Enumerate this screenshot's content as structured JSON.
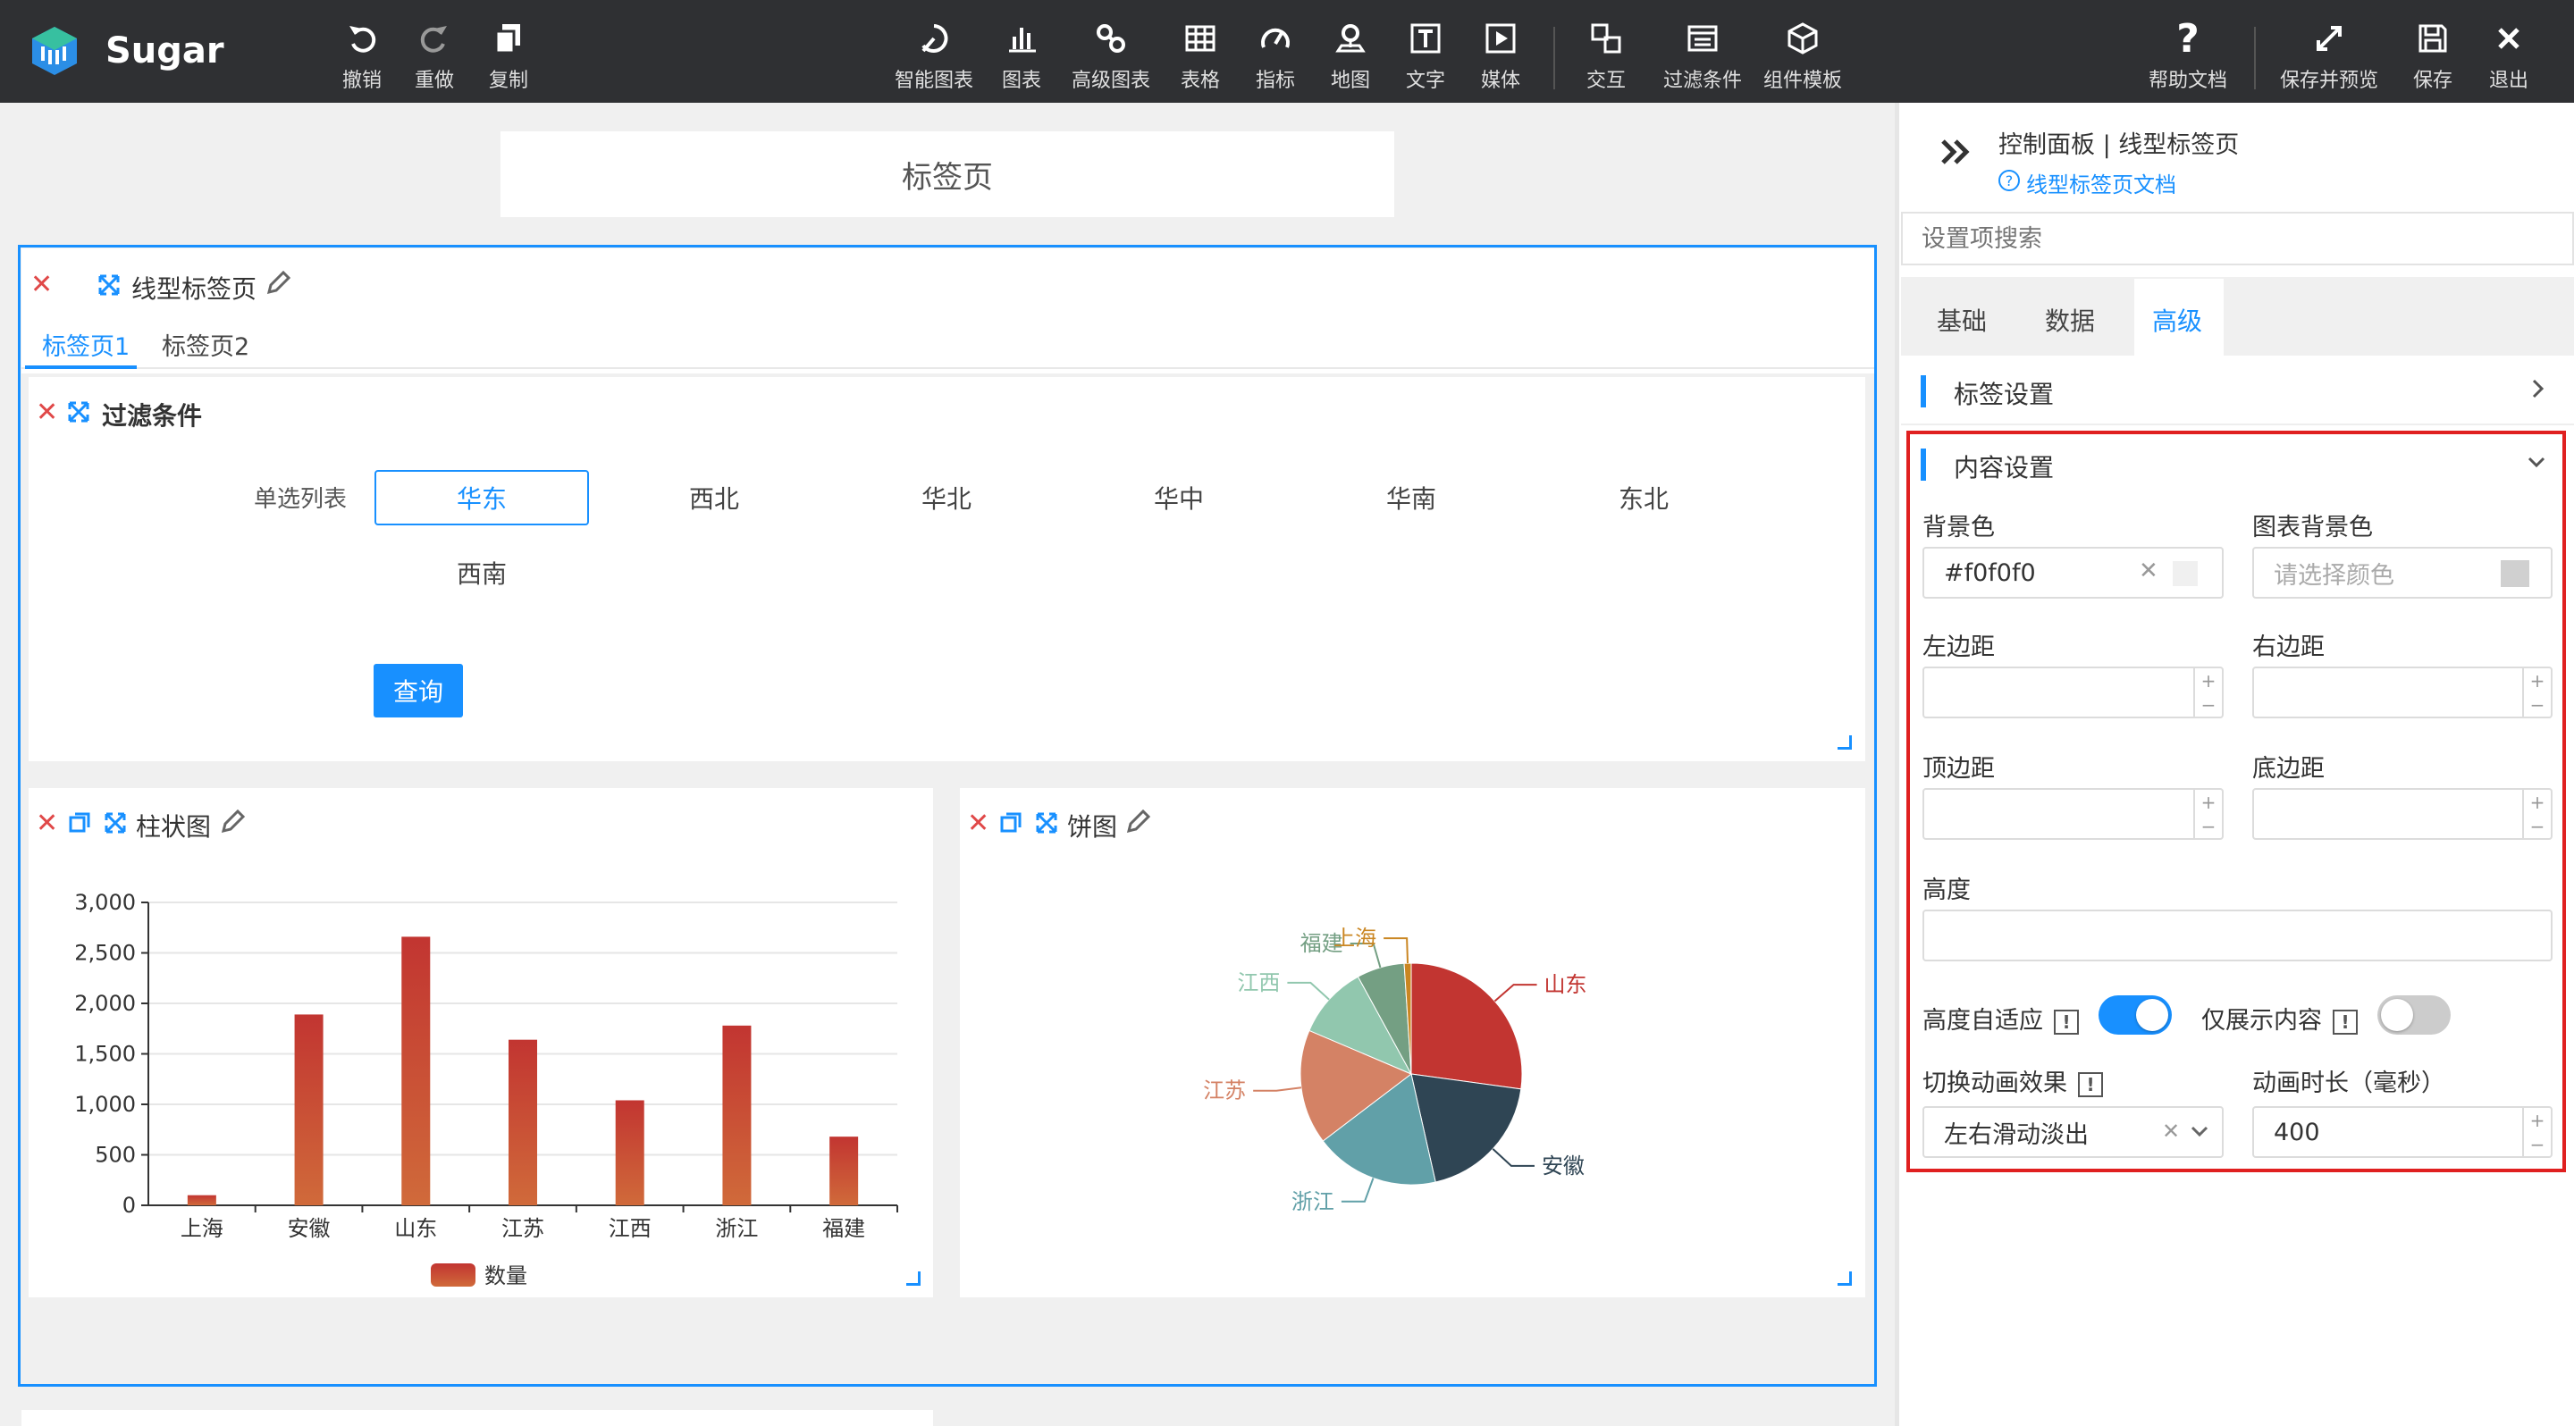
{
  "app": {
    "name": "Sugar"
  },
  "toolbar": {
    "undo": "撤销",
    "redo": "重做",
    "copy": "复制",
    "smart_chart": "智能图表",
    "chart": "图表",
    "adv_chart": "高级图表",
    "table": "表格",
    "metric": "指标",
    "map": "地图",
    "text": "文字",
    "media": "媒体",
    "interact": "交互",
    "filter": "过滤条件",
    "component_tpl": "组件模板",
    "help": "帮助文档",
    "save_preview": "保存并预览",
    "save": "保存",
    "exit": "退出"
  },
  "canvas": {
    "page_title": "标签页",
    "tabs_component": {
      "title": "线型标签页",
      "tabs": [
        "标签页1",
        "标签页2"
      ],
      "active": 0
    },
    "filter": {
      "title": "过滤条件",
      "label": "单选列表",
      "options": [
        "华东",
        "西北",
        "华北",
        "华中",
        "华南",
        "东北",
        "西南"
      ],
      "selected": "华东",
      "query_button": "查询"
    },
    "bar_title": "柱状图",
    "pie_title": "饼图"
  },
  "chart_data": [
    {
      "type": "bar",
      "categories": [
        "上海",
        "安徽",
        "山东",
        "江苏",
        "江西",
        "浙江",
        "福建"
      ],
      "series": [
        {
          "name": "数量",
          "values": [
            100,
            1890,
            2660,
            1640,
            1040,
            1780,
            680
          ]
        }
      ],
      "ylim": [
        0,
        3000
      ],
      "yticks": [
        0,
        500,
        1000,
        1500,
        2000,
        2500,
        3000
      ],
      "ytick_labels": [
        "0",
        "500",
        "1,000",
        "1,500",
        "2,000",
        "2,500",
        "3,000"
      ],
      "grid": true,
      "legend": "bottom",
      "color": "#c23531"
    },
    {
      "type": "pie",
      "slices": [
        {
          "name": "山东",
          "value": 2660,
          "color": "#c23531"
        },
        {
          "name": "安徽",
          "value": 1890,
          "color": "#2f4554"
        },
        {
          "name": "浙江",
          "value": 1780,
          "color": "#61a0a8"
        },
        {
          "name": "江苏",
          "value": 1640,
          "color": "#d48265"
        },
        {
          "name": "江西",
          "value": 1040,
          "color": "#91c7ae"
        },
        {
          "name": "福建",
          "value": 680,
          "color": "#749f83"
        },
        {
          "name": "上海",
          "value": 100,
          "color": "#ca8622"
        }
      ]
    }
  ],
  "panel": {
    "breadcrumb": "控制面板 | 线型标签页",
    "doc_link": "线型标签页文档",
    "search_placeholder": "设置项搜索",
    "tabs": [
      "基础",
      "数据",
      "高级"
    ],
    "active_tab": 2,
    "section_tab_settings": "标签设置",
    "section_content_settings": "内容设置",
    "bg_color_label": "背景色",
    "bg_color_value": "#f0f0f0",
    "chart_bg_label": "图表背景色",
    "chart_bg_placeholder": "请选择颜色",
    "left_margin": "左边距",
    "right_margin": "右边距",
    "top_margin": "顶边距",
    "bottom_margin": "底边距",
    "height": "高度",
    "auto_height": "高度自适应",
    "auto_height_on": true,
    "content_only": "仅展示内容",
    "content_only_on": false,
    "switch_anim": "切换动画效果",
    "switch_anim_value": "左右滑动淡出",
    "anim_duration": "动画时长（毫秒）",
    "anim_duration_value": "400",
    "accent": "#1890ff",
    "highlight": "#e02020"
  }
}
